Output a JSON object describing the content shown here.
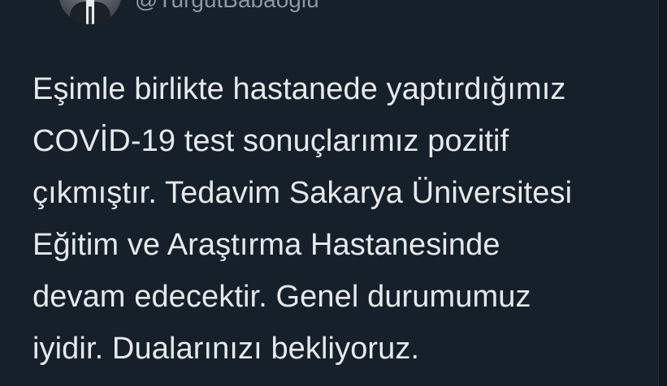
{
  "author": {
    "handle": "@TurgutBabaoglu"
  },
  "tweet": {
    "lines": [
      "Eşimle birlikte hastanede yaptırdığımız",
      "COVİD-19 test sonuçlarımız pozitif",
      "çıkmıştır. Tedavim Sakarya Üniversitesi",
      "Eğitim ve Araştırma Hastanesinde",
      "devam edecektir. Genel durumumuz",
      "iyidir. Dualarınızı bekliyoruz."
    ]
  },
  "colors": {
    "background": "#15202b",
    "text": "#e7e9ea",
    "muted": "#8b98a5"
  }
}
